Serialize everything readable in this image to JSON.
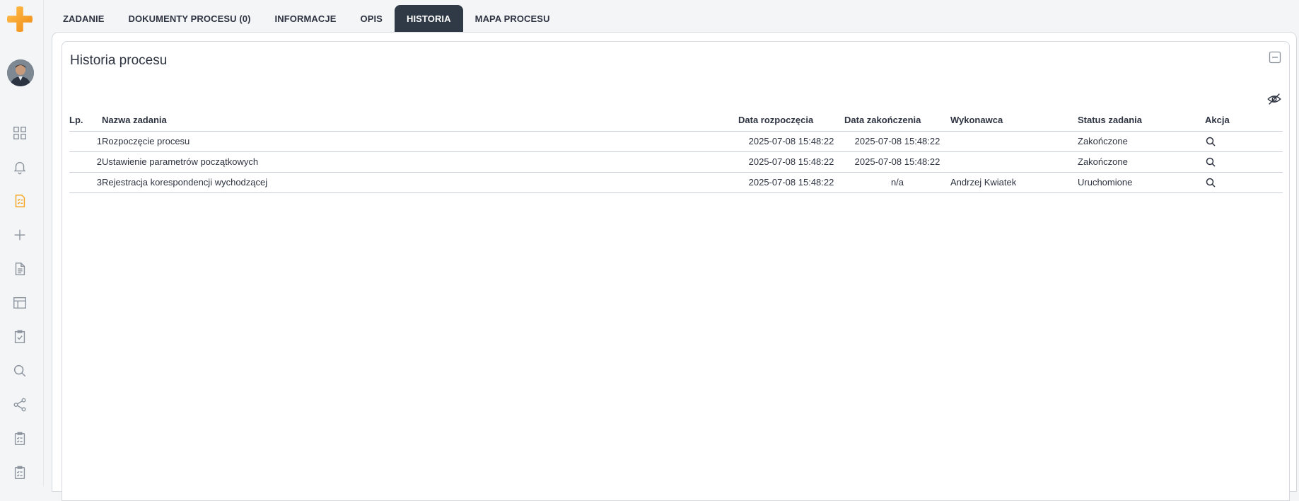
{
  "tabs": [
    {
      "label": "ZADANIE",
      "active": false
    },
    {
      "label": "DOKUMENTY PROCESU (0)",
      "active": false
    },
    {
      "label": "INFORMACJE",
      "active": false
    },
    {
      "label": "OPIS",
      "active": false
    },
    {
      "label": "HISTORIA",
      "active": true
    },
    {
      "label": "MAPA PROCESU",
      "active": false
    }
  ],
  "card": {
    "title": "Historia procesu"
  },
  "table": {
    "headers": {
      "lp": "Lp.",
      "name": "Nazwa zadania",
      "start": "Data rozpoczęcia",
      "end": "Data zakończenia",
      "executor": "Wykonawca",
      "status": "Status zadania",
      "action": "Akcja"
    },
    "rows": [
      {
        "lp": "1",
        "name": "Rozpoczęcie procesu",
        "start": "2025-07-08 15:48:22",
        "end": "2025-07-08 15:48:22",
        "executor": "",
        "status": "Zakończone"
      },
      {
        "lp": "2",
        "name": "Ustawienie parametrów początkowych",
        "start": "2025-07-08 15:48:22",
        "end": "2025-07-08 15:48:22",
        "executor": "",
        "status": "Zakończone"
      },
      {
        "lp": "3",
        "name": "Rejestracja korespondencji wychodzącej",
        "start": "2025-07-08 15:48:22",
        "end": "n/a",
        "executor": "Andrzej Kwiatek",
        "status": "Uruchomione"
      }
    ]
  },
  "colors": {
    "accent": "#f5a623",
    "active_tab": "#2f3a46",
    "icon_gray": "#8a929c"
  },
  "sidebar_icons": [
    "grid-icon",
    "bell-icon",
    "tasks-icon",
    "plus-icon",
    "document-icon",
    "layout-icon",
    "clipboard-check-icon",
    "search-icon",
    "share-icon",
    "checklist-icon",
    "checklist-icon"
  ]
}
